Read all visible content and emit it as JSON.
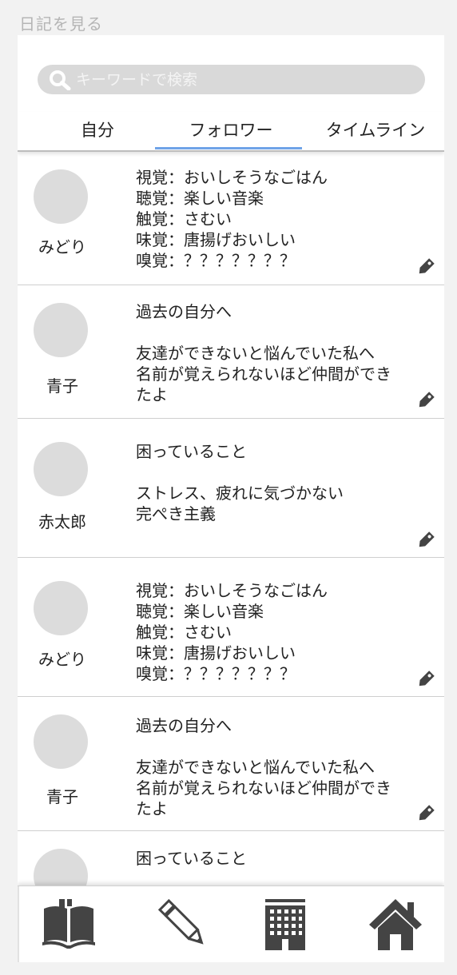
{
  "page_title": "日記を見る",
  "search": {
    "placeholder": "キーワードで検索",
    "value": ""
  },
  "tabs": [
    {
      "label": "自分",
      "active": false
    },
    {
      "label": "フォロワー",
      "active": true
    },
    {
      "label": "タイムライン",
      "active": false
    }
  ],
  "entries": [
    {
      "user": "みどり",
      "text": "視覚：おいしそうなごはん\n聴覚：楽しい音楽\n触覚：さむい\n味覚：唐揚げおいしい\n嗅覚：？？？？？？？",
      "tag_icon": "tag-icon"
    },
    {
      "user": "青子",
      "text": "過去の自分へ\n\n友達ができないと悩んでいた私へ\n名前が覚えられないほど仲間ができ\nたよ",
      "tag_icon": "tag-icon"
    },
    {
      "user": "赤太郎",
      "text": "困っていること\n\nストレス、疲れに気づかない\n完ぺき主義",
      "tag_icon": "tag-icon"
    },
    {
      "user": "みどり",
      "text": "視覚：おいしそうなごはん\n聴覚：楽しい音楽\n触覚：さむい\n味覚：唐揚げおいしい\n嗅覚：？？？？？？？",
      "tag_icon": "tag-icon"
    },
    {
      "user": "青子",
      "text": "過去の自分へ\n\n友達ができないと悩んでいた私へ\n名前が覚えられないほど仲間ができ\nたよ",
      "tag_icon": "tag-icon"
    },
    {
      "user": "",
      "text": "困っていること",
      "tag_icon": "tag-icon"
    }
  ],
  "nav": [
    {
      "icon": "book-icon"
    },
    {
      "icon": "pencil-icon"
    },
    {
      "icon": "building-icon"
    },
    {
      "icon": "home-icon"
    }
  ],
  "colors": {
    "background": "#f2f2f2",
    "search_bar": "#d9d9d9",
    "tab_indicator": "#6fa3e8",
    "avatar": "#dcdcdc",
    "icon": "#444444",
    "title": "#b5b5b5"
  }
}
